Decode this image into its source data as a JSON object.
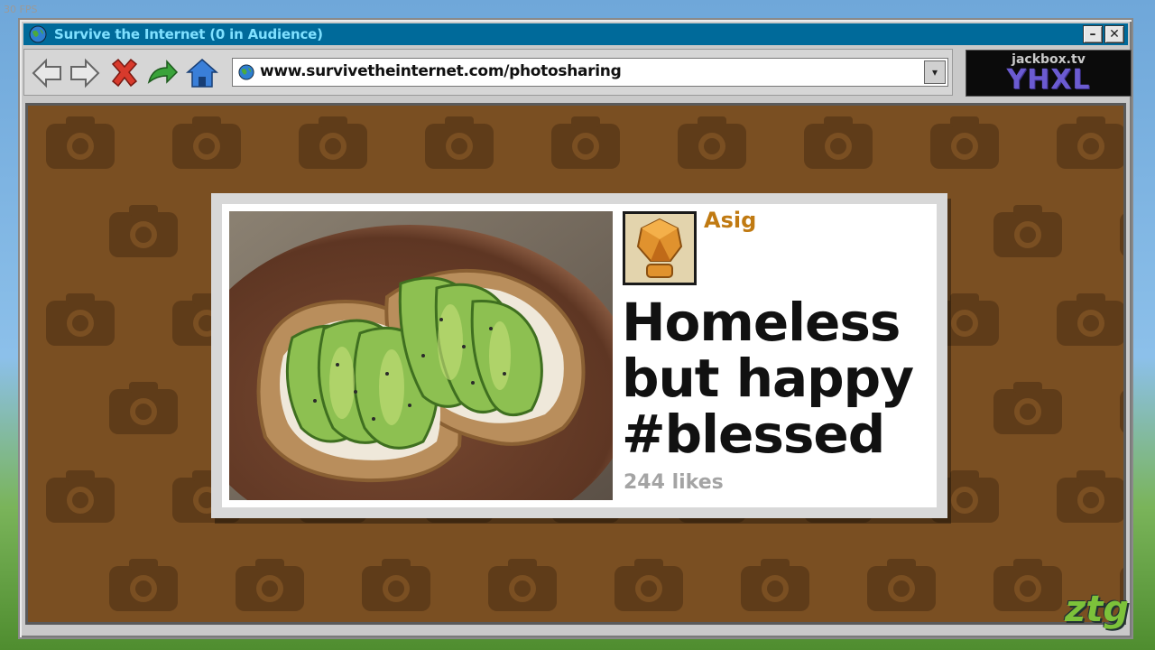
{
  "fps": "30 FPS",
  "window": {
    "title": "Survive the Internet  (0 in Audience)",
    "minimize_label": "–",
    "close_label": "✕"
  },
  "toolbar": {
    "icons": [
      "back-arrow-icon",
      "forward-arrow-icon",
      "stop-x-icon",
      "refresh-arrow-icon",
      "home-icon"
    ],
    "url": "www.survivetheinternet.com/photosharing",
    "dropdown_label": "▾"
  },
  "room": {
    "site": "jackbox.tv",
    "code": "YHXL"
  },
  "post": {
    "username": "Asig",
    "caption_line1": "Homeless",
    "caption_line2": "but happy",
    "caption_line3": "#blessed",
    "likes": "244 likes",
    "photo_description_icon": "avocado-toast-photo"
  },
  "watermark": "ztg",
  "colors": {
    "titlebar": "#006a9a",
    "title_text": "#7fe0ff",
    "background_brown": "#7a4f22",
    "username": "#c07a12",
    "room_code": "#6b5bd1"
  }
}
